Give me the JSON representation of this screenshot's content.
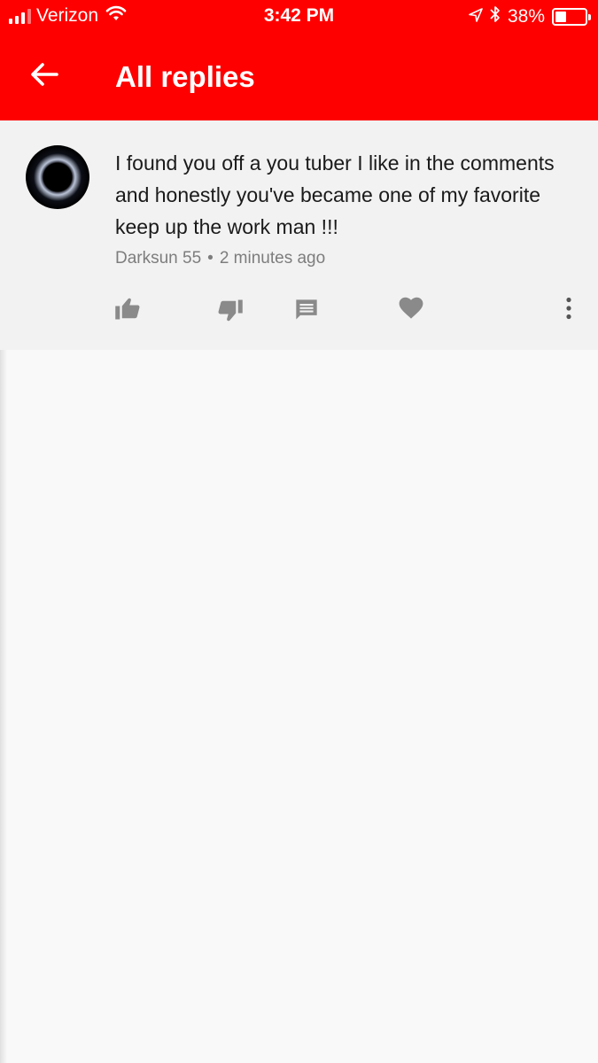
{
  "status_bar": {
    "carrier": "Verizon",
    "time": "3:42 PM",
    "battery_percent_label": "38%",
    "battery_level": 0.38
  },
  "header": {
    "title": "All replies",
    "back_icon": "arrow-left-icon"
  },
  "comment": {
    "text": "I found you off a you tuber I like in the comments and honestly you've became one of my favorite keep up the work man !!!",
    "author": "Darksun 55",
    "separator": "•",
    "time_ago": "2 minutes ago",
    "actions": [
      "thumb-up-icon",
      "thumb-down-icon",
      "reply-icon",
      "heart-icon",
      "more-vert-icon"
    ]
  },
  "colors": {
    "header_bg": "#ff0000",
    "card_bg": "#f2f2f2",
    "page_bg": "#f9f9f9",
    "icon_gray": "#8a8a8a",
    "meta_gray": "#7d7d7d"
  }
}
